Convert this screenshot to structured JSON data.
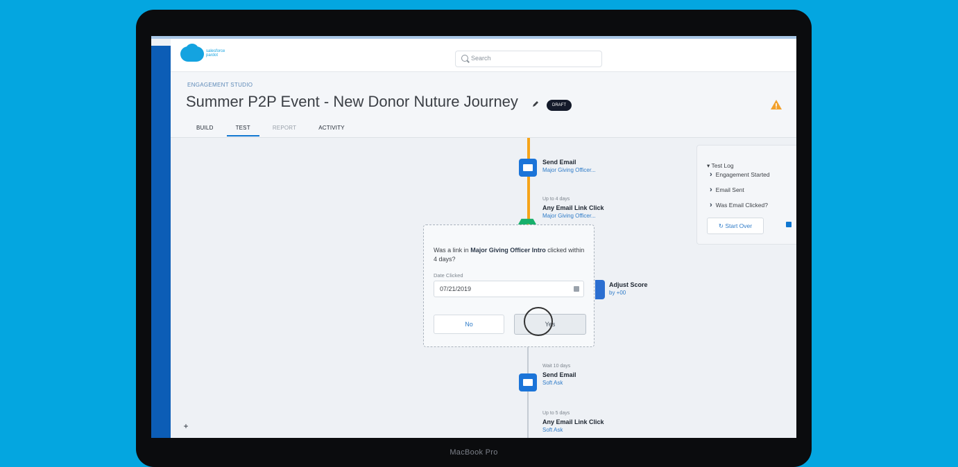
{
  "device_label": "MacBook Pro",
  "header": {
    "logo_text": "salesforce pardot",
    "search_placeholder": "Search"
  },
  "page": {
    "eyebrow": "ENGAGEMENT STUDIO",
    "title": "Summer P2P Event - New Donor Nuture Journey",
    "status_badge": "DRAFT",
    "tabs": [
      {
        "label": "BUILD"
      },
      {
        "label": "TEST"
      },
      {
        "label": "REPORT"
      },
      {
        "label": "ACTIVITY"
      }
    ]
  },
  "flow": {
    "step1_title": "Send Email",
    "step1_sub": "Major Giving Officer...",
    "step2_pre": "Up to 4 days",
    "step2_title": "Any Email Link Click",
    "step2_sub": "Major Giving Officer...",
    "adjust_title": "Adjust Score",
    "adjust_sub": "by +00",
    "step3_pre": "Wait 10 days",
    "step3_title": "Send Email",
    "step3_sub": "Soft Ask",
    "step4_pre": "Up to 5 days",
    "step4_title": "Any Email Link Click",
    "step4_sub": "Soft Ask"
  },
  "popup": {
    "question_prefix": "Was a link in",
    "question_bold": "Major Giving Officer Intro",
    "question_suffix": "clicked within 4 days?",
    "date_label": "Date Clicked",
    "date_value": "07/21/2019",
    "no_label": "No",
    "yes_label": "Yes"
  },
  "test_log": {
    "title": "Test Log",
    "items": [
      "Engagement Started",
      "Email Sent",
      "Was Email Clicked?"
    ],
    "start_over_label": "Start Over"
  },
  "zoom": {
    "plus": "+",
    "fit": "⤢",
    "minus": "−"
  }
}
